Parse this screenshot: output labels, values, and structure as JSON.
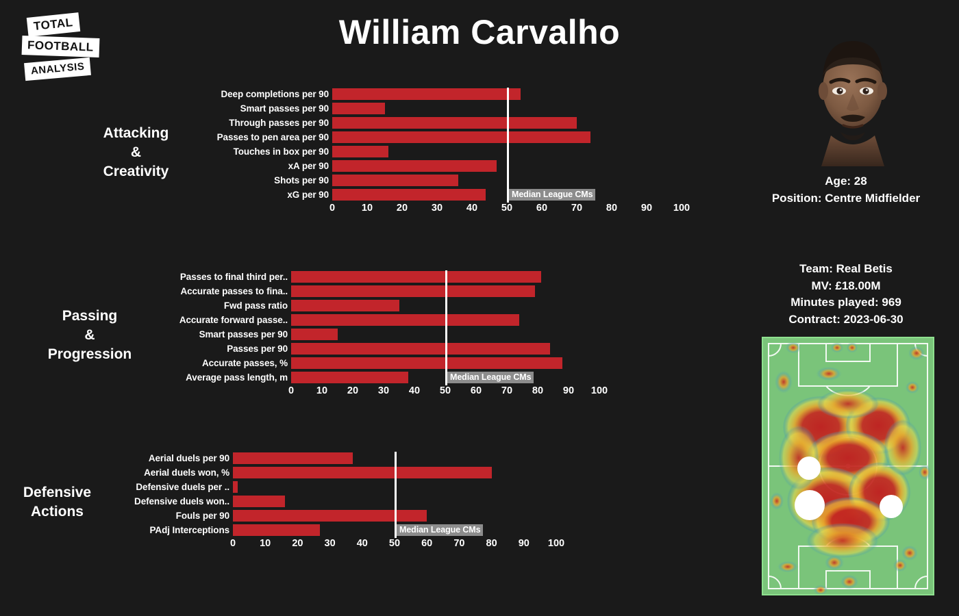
{
  "brand": {
    "logo_line1": "TOTAL",
    "logo_line2": "FOOTBALL",
    "logo_line3": "ANALYSIS"
  },
  "header": {
    "title": "William Carvalho"
  },
  "player": {
    "age": "Age: 28",
    "position": "Position: Centre Midfielder",
    "team": "Team: Real Betis",
    "market_value": "MV: £18.00M",
    "minutes_played": "Minutes played: 969",
    "contract": "Contract: 2023-06-30",
    "photo_alt": "player-portrait",
    "heatmap_alt": "player-heatmap-pitch"
  },
  "colors": {
    "background": "#1a1a1a",
    "bar": "#c2252b",
    "median_line": "#ffffff",
    "median_label_bg": "#8c8c8c",
    "pitch_green": "#7ac47a"
  },
  "chart_data": [
    {
      "type": "bar",
      "orientation": "horizontal",
      "title": "Attacking\n&\nCreativity",
      "xlabel": "",
      "ylabel": "",
      "xlim": [
        0,
        100
      ],
      "xticks": [
        0,
        10,
        20,
        30,
        40,
        50,
        60,
        70,
        80,
        90,
        100
      ],
      "grid": false,
      "median_value": 50,
      "median_label": "Median League CMs",
      "categories": [
        "Deep completions per 90",
        "Smart passes per 90",
        "Through passes per 90",
        "Passes to pen area per 90",
        "Touches in box per 90",
        "xA per 90",
        "Shots per 90",
        "xG per 90"
      ],
      "values": [
        54,
        15,
        70,
        74,
        16,
        47,
        36,
        44
      ]
    },
    {
      "type": "bar",
      "orientation": "horizontal",
      "title": "Passing\n&\nProgression",
      "xlabel": "",
      "ylabel": "",
      "xlim": [
        0,
        100
      ],
      "xticks": [
        0,
        10,
        20,
        30,
        40,
        50,
        60,
        70,
        80,
        90,
        100
      ],
      "grid": false,
      "median_value": 50,
      "median_label": "Median League CMs",
      "categories": [
        "Passes to final third per..",
        "Accurate passes to fina..",
        "Fwd pass ratio",
        "Accurate forward passe..",
        "Smart passes per 90",
        "Passes per 90",
        "Accurate passes, %",
        "Average pass length, m"
      ],
      "values": [
        81,
        79,
        35,
        74,
        15,
        84,
        88,
        38
      ]
    },
    {
      "type": "bar",
      "orientation": "horizontal",
      "title": "Defensive\nActions",
      "xlabel": "",
      "ylabel": "",
      "xlim": [
        0,
        100
      ],
      "xticks": [
        0,
        10,
        20,
        30,
        40,
        50,
        60,
        70,
        80,
        90,
        100
      ],
      "grid": false,
      "median_value": 50,
      "median_label": "Median League CMs",
      "categories": [
        "Aerial duels per 90",
        "Aerial duels won, %",
        "Defensive duels per ..",
        "Defensive duels won..",
        "Fouls per 90",
        "PAdj Interceptions"
      ],
      "values": [
        37,
        80,
        1.5,
        16,
        60,
        27
      ]
    }
  ]
}
